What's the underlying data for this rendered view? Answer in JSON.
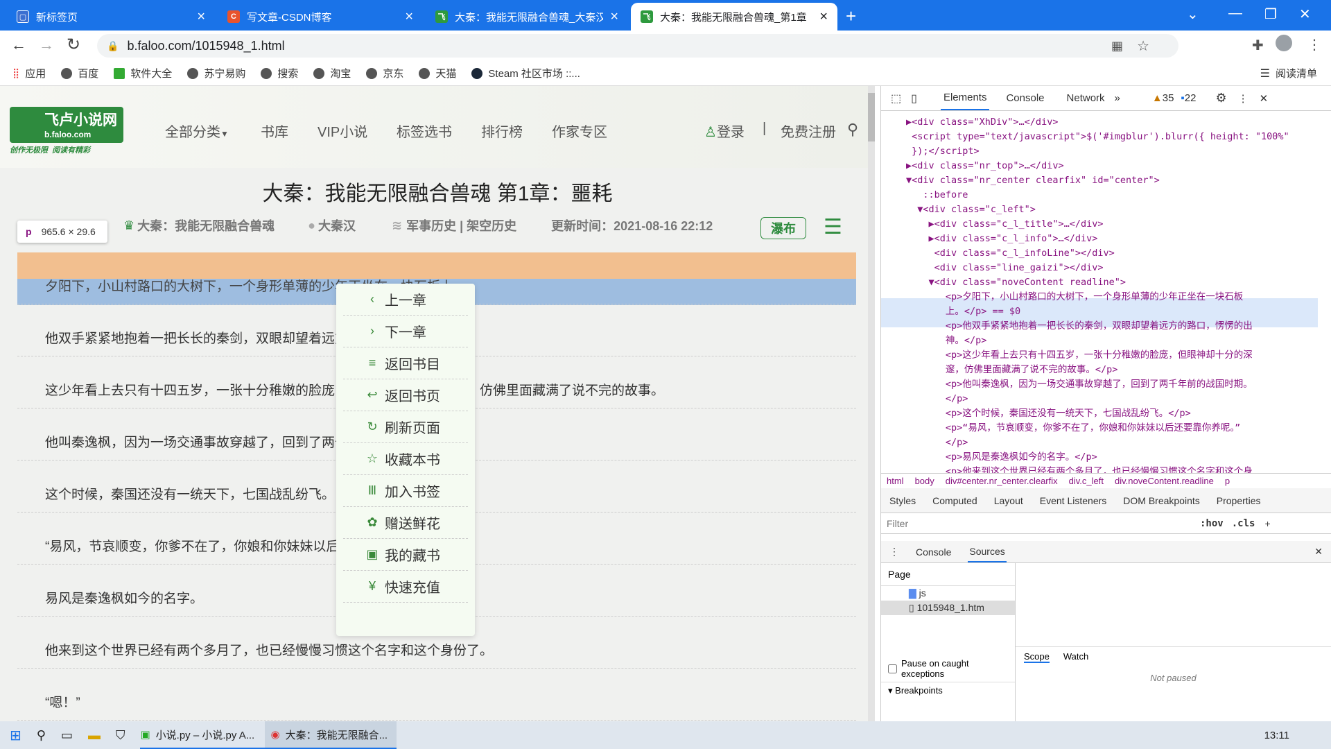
{
  "browser": {
    "tabs": [
      {
        "title": "新标签页",
        "icon": "new-tab-icon"
      },
      {
        "title": "写文章-CSDN博客",
        "icon": "csdn-icon"
      },
      {
        "title": "大秦：我能无限融合兽魂_大秦汉",
        "icon": "faloo-icon"
      },
      {
        "title": "大秦：我能无限融合兽魂_第1章",
        "icon": "faloo-icon"
      }
    ],
    "url": "b.faloo.com/1015948_1.html",
    "bookmarks": [
      "应用",
      "百度",
      "软件大全",
      "苏宁易购",
      "搜索",
      "淘宝",
      "京东",
      "天猫",
      "Steam 社区市场 ::..."
    ],
    "reading_list": "阅读清单"
  },
  "site": {
    "logo_text": "飞卢小说网",
    "logo_sub": "b.faloo.com",
    "logo_slogan": "创作无极限  阅读有精彩",
    "nav": [
      "全部分类",
      "书库",
      "VIP小说",
      "标签选书",
      "排行榜",
      "作家专区"
    ],
    "login": "登录",
    "divider": "|",
    "register": "免费注册"
  },
  "chapter": {
    "title": "大秦：我能无限融合兽魂 第1章：噩耗",
    "book": "大秦：我能无限融合兽魂",
    "author": "大秦汉",
    "category": "军事历史 | 架空历史",
    "updated": "更新时间：2021-08-16 22:12",
    "mode_button": "瀑布",
    "inspect_tag": "p",
    "inspect_size": "965.6 × 29.6",
    "paragraphs": [
      "夕阳下，小山村路口的大树下，一个身形单薄的少年正坐在一块石板上。",
      "他双手紧紧地抱着一把长长的秦剑，双眼却望着远方的路口，愣愣的出神。",
      "这少年看上去只有十四五岁，一张十分稚嫩的脸庞，但眼神却十分的深邃，仿佛里面藏满了说不完的故事。",
      "他叫秦逸枫，因为一场交通事故穿越了，回到了两千年前的战国时期。",
      "这个时候，秦国还没有一统天下，七国战乱纷飞。",
      "“易风，节哀顺变，你爹不在了，你娘和你妹妹以后还要靠你养呢。”",
      "易风是秦逸枫如今的名字。",
      "他来到这个世界已经有两个多月了，也已经慢慢习惯这个名字和这个身份了。",
      "“嗯！”"
    ]
  },
  "menu": [
    {
      "label": "上一章",
      "icon": "chevron-left-icon",
      "glyph": "‹"
    },
    {
      "label": "下一章",
      "icon": "chevron-right-icon",
      "glyph": "›"
    },
    {
      "label": "返回书目",
      "icon": "list-icon",
      "glyph": "≡"
    },
    {
      "label": "返回书页",
      "icon": "return-icon",
      "glyph": "↩"
    },
    {
      "label": "刷新页面",
      "icon": "refresh-icon",
      "glyph": "↻"
    },
    {
      "label": "收藏本书",
      "icon": "star-icon",
      "glyph": "☆"
    },
    {
      "label": "加入书签",
      "icon": "bookmark-icon",
      "glyph": "Ⅲ"
    },
    {
      "label": "赠送鲜花",
      "icon": "flower-icon",
      "glyph": "✿"
    },
    {
      "label": "我的藏书",
      "icon": "bookshelf-icon",
      "glyph": "▣"
    },
    {
      "label": "快速充值",
      "icon": "coin-icon",
      "glyph": "¥"
    }
  ],
  "devtools": {
    "tabs": [
      "Elements",
      "Console",
      "Network"
    ],
    "warnings": "35",
    "messages": "22",
    "lines": [
      "▶<div class=\"XhDiv\">…</div>",
      " <script type=\"text/javascript\">$('#imgblur').blurr({ height: \"100%\"",
      " });</script>",
      "▶<div class=\"nr_top\">…</div>",
      "▼<div class=\"nr_center clearfix\" id=\"center\">",
      "   ::before",
      "  ▼<div class=\"c_left\">",
      "    ▶<div class=\"c_l_title\">…</div>",
      "    ▶<div class=\"c_l_info\">…</div>",
      "     <div class=\"c_l_infoLine\"></div>",
      "     <div class=\"line_gaizi\"></div>",
      "    ▼<div class=\"noveContent readline\">",
      "       <p>夕阳下，小山村路口的大树下，一个身形单薄的少年正坐在一块石板",
      "       上。</p> == $0",
      "       <p>他双手紧紧地抱着一把长长的秦剑，双眼却望着远方的路口，愣愣的出",
      "       神。</p>",
      "       <p>这少年看上去只有十四五岁，一张十分稚嫩的脸庞，但眼神却十分的深",
      "       邃，仿佛里面藏满了说不完的故事。</p>",
      "       <p>他叫秦逸枫，因为一场交通事故穿越了，回到了两千年前的战国时期。",
      "       </p>",
      "       <p>这个时候，秦国还没有一统天下，七国战乱纷飞。</p>",
      "       <p>“易风，节哀顺变，你爹不在了，你娘和你妹妹以后还要靠你养呢。”",
      "       </p>",
      "       <p>易风是秦逸枫如今的名字。</p>",
      "       <p>他来到这个世界已经有两个多月了，也已经慢慢习惯这个名字和这个身"
    ],
    "breadcrumb": [
      "html",
      "body",
      "div#center.nr_center.clearfix",
      "div.c_left",
      "div.noveContent.readline",
      "p"
    ],
    "style_tabs": [
      "Styles",
      "Computed",
      "Layout",
      "Event Listeners",
      "DOM Breakpoints",
      "Properties"
    ],
    "filter_placeholder": "Filter",
    "hov": ":hov",
    "cls": ".cls",
    "drawer_tabs": [
      "Console",
      "Sources"
    ],
    "page_label": "Page",
    "tree": [
      "js",
      "1015948_1.htm"
    ],
    "scope": "Scope",
    "watch": "Watch",
    "not_paused": "Not paused",
    "pause_label": "Pause on caught exceptions",
    "breakpoints": "Breakpoints"
  },
  "taskbar": {
    "items": [
      "小说.py – 小说.py A...",
      "大秦：我能无限融合..."
    ],
    "clock": "13:11"
  }
}
